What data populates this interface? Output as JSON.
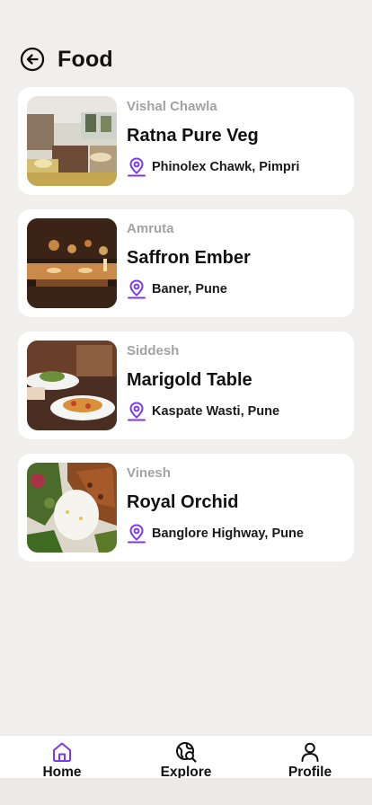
{
  "header": {
    "title": "Food",
    "back_icon": "arrow-left-circle-icon"
  },
  "restaurants": [
    {
      "owner": "Vishal Chawla",
      "name": "Ratna Pure Veg",
      "location": "Phinolex Chawk, Pimpri",
      "image": "restaurant-interior"
    },
    {
      "owner": "Amruta",
      "name": "Saffron Ember",
      "location": "Baner, Pune",
      "image": "candlelit-dining"
    },
    {
      "owner": "Siddesh",
      "name": "Marigold Table",
      "location": "Kaspate Wasti, Pune",
      "image": "plated-dishes"
    },
    {
      "owner": "Vinesh",
      "name": "Royal Orchid",
      "location": "Banglore Highway, Pune",
      "image": "rice-and-kebab-plate"
    }
  ],
  "location_icon": "map-pin-icon",
  "colors": {
    "accent": "#7c3aed",
    "background": "#f0efee",
    "card": "#ffffff",
    "muted_text": "#a3a3a3"
  },
  "nav": {
    "active": "home",
    "items": [
      {
        "key": "home",
        "label": "Home",
        "icon": "home-icon"
      },
      {
        "key": "explore",
        "label": "Explore",
        "icon": "explore-globe-icon"
      },
      {
        "key": "profile",
        "label": "Profile",
        "icon": "user-icon"
      }
    ]
  }
}
